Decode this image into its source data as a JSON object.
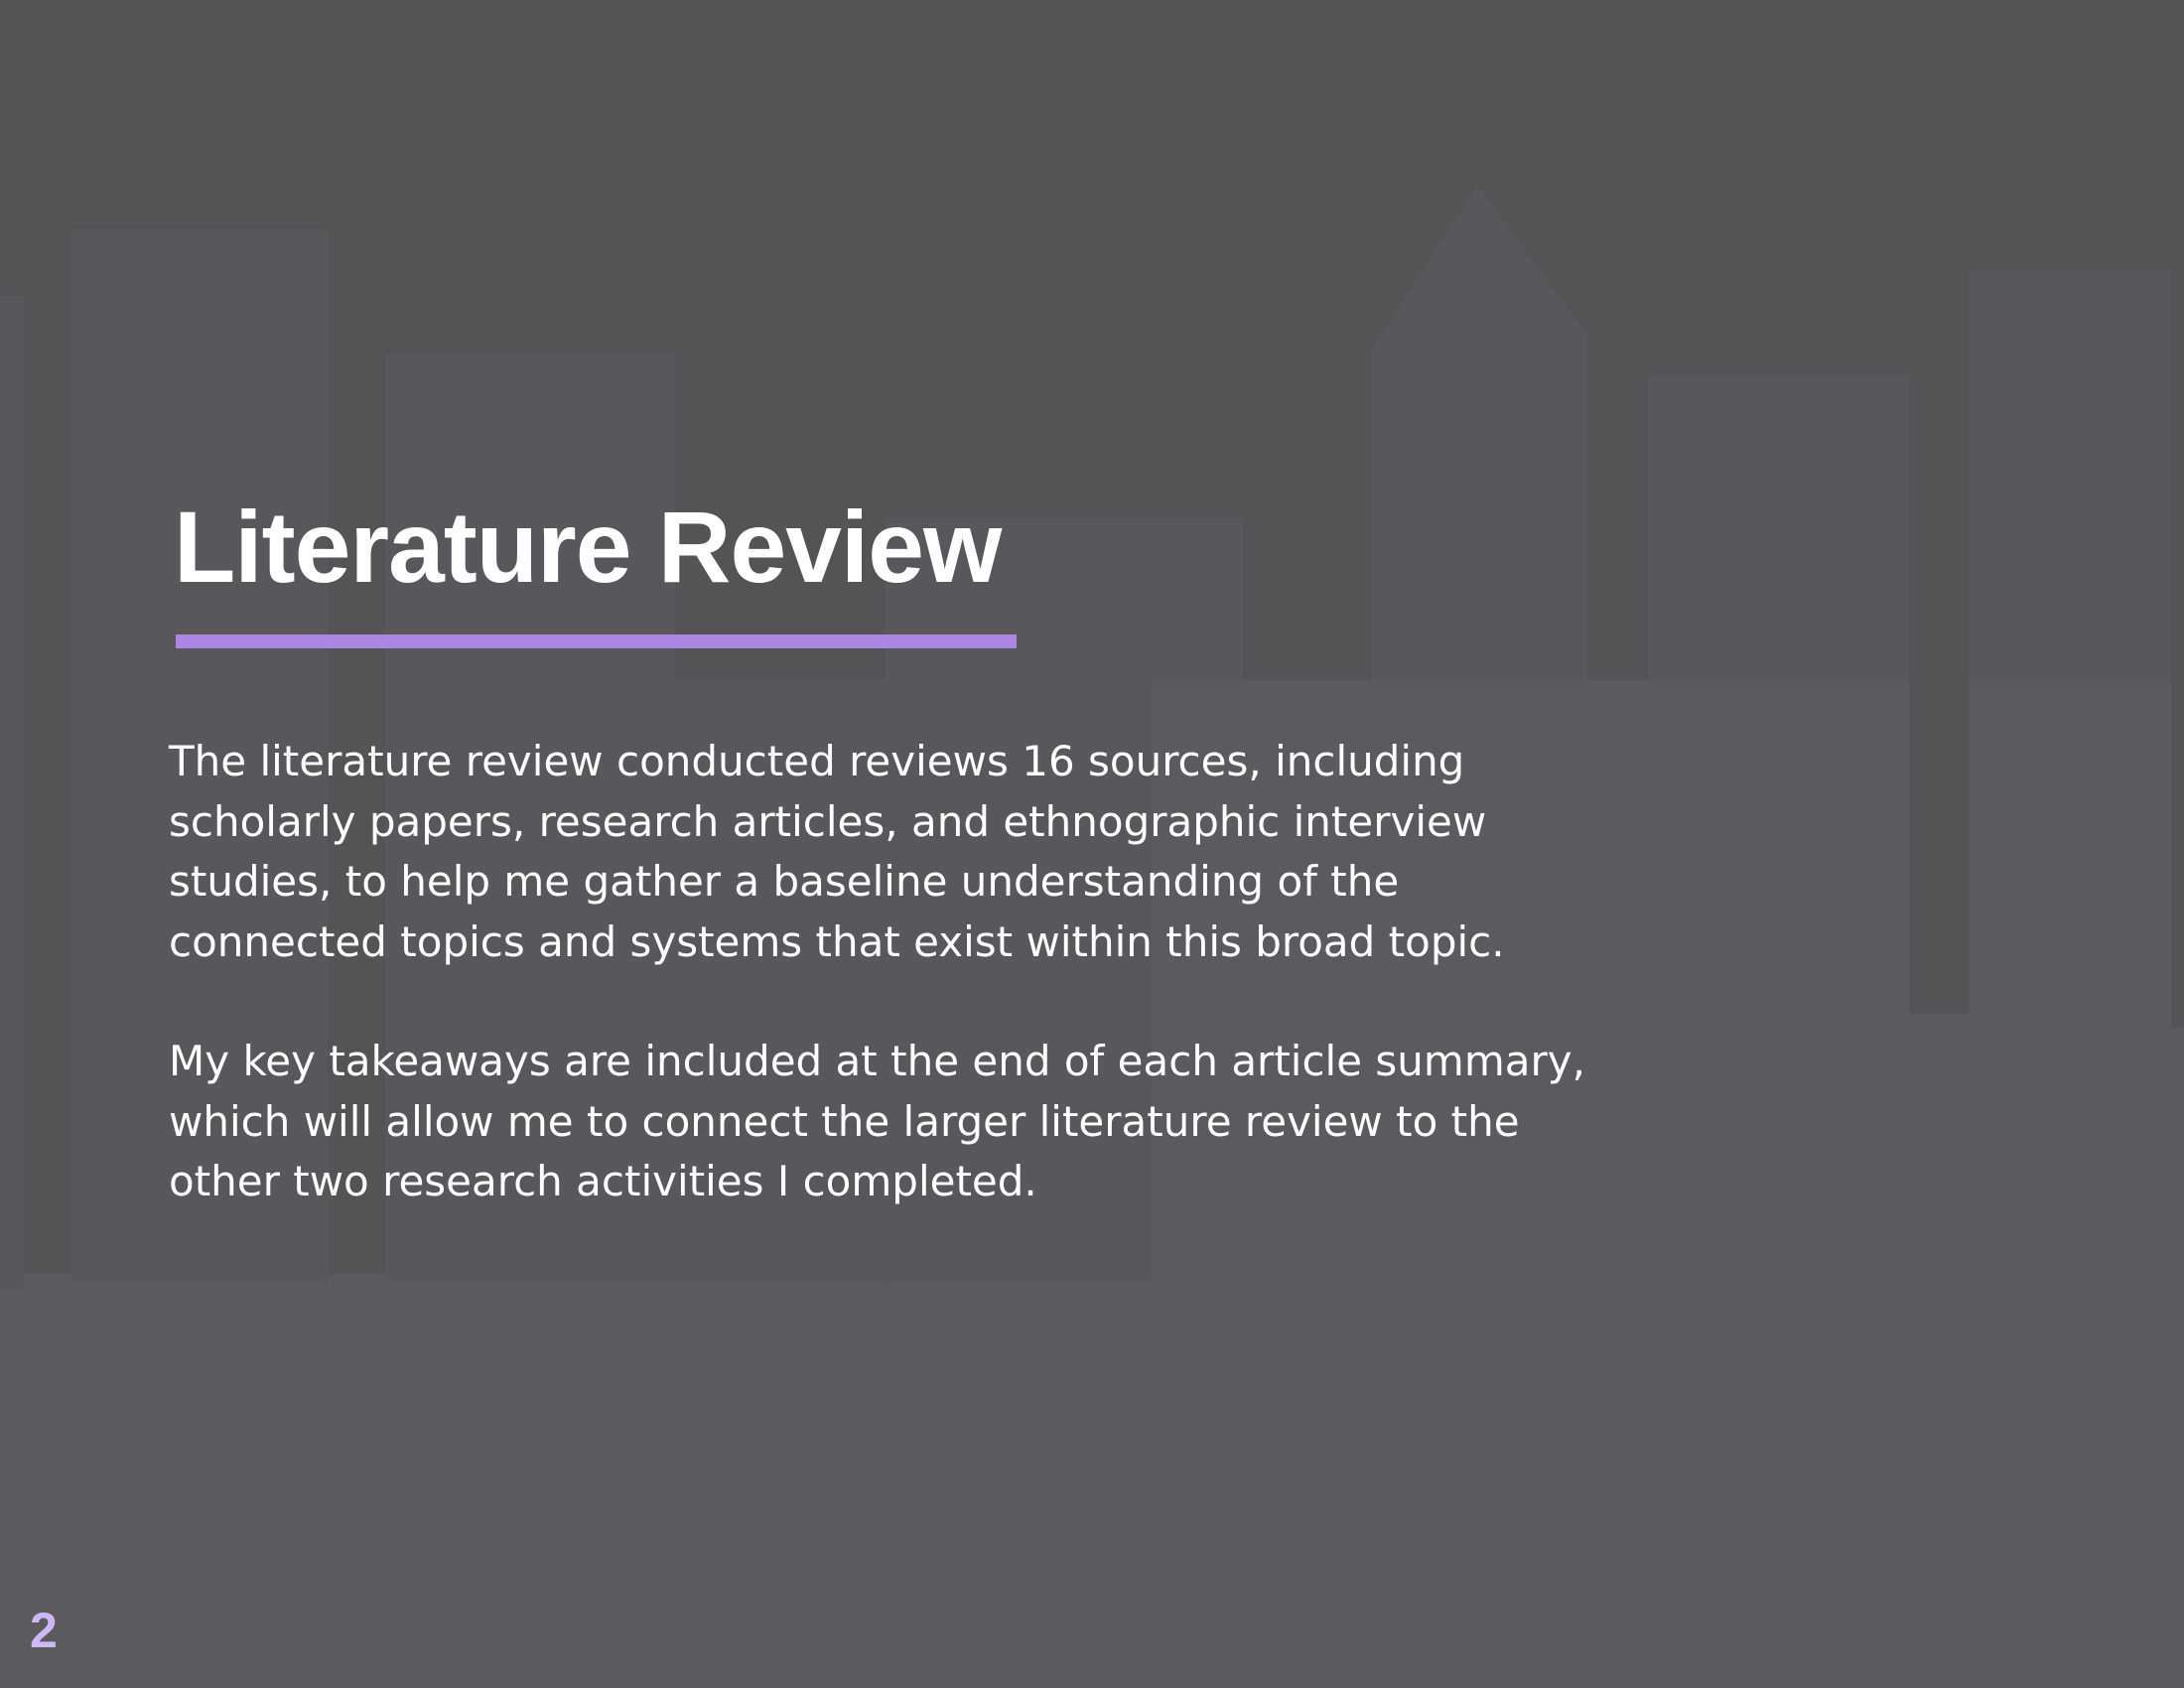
{
  "slide": {
    "title": "Literature Review",
    "paragraphs": [
      "The literature review conducted reviews 16 sources, including\nscholarly papers, research articles, and ethnographic interview\nstudies, to help me gather a baseline understanding of the\nconnected topics and systems that exist within this broad topic.",
      "My key takeaways are included at the end of each article summary,\nwhich will allow me to connect the larger literature review to the\nother two research activities I completed."
    ],
    "page_number": "2"
  },
  "colors": {
    "background": "#5b5b5d",
    "skyline_dark": "#545454",
    "skyline_light": "#58585a",
    "accent_underline": "#ad86e4",
    "page_number": "#cdb8f5",
    "text": "#ffffff"
  }
}
